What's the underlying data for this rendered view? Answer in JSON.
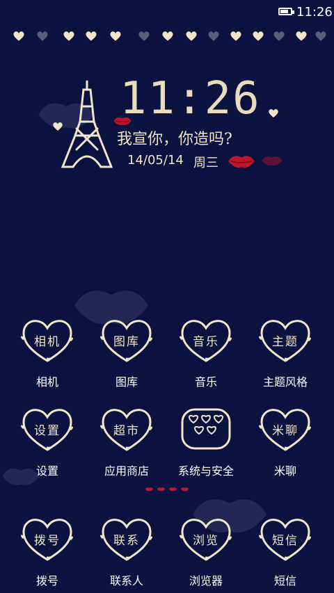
{
  "status_bar": {
    "time": "11:26",
    "battery_level": 0.8,
    "battery_icon": "battery-icon"
  },
  "heart_strip": {
    "icon": "heart-icon",
    "colors": [
      "#f1e6c9",
      "#5a5e78"
    ]
  },
  "clock_widget": {
    "time": "11:26",
    "slogan": "我宣你，你造吗?",
    "date": "14/05/14",
    "weekday": "周三",
    "icons": [
      "eiffel-tower-icon",
      "lips-icon"
    ],
    "accent_color": "#c0142a"
  },
  "apps": [
    {
      "icon_text": "相机",
      "label": "相机"
    },
    {
      "icon_text": "图库",
      "label": "图库"
    },
    {
      "icon_text": "音乐",
      "label": "音乐"
    },
    {
      "icon_text": "主题",
      "label": "主题风格"
    },
    {
      "icon_text": "设置",
      "label": "设置"
    },
    {
      "icon_text": "超市",
      "label": "应用商店"
    },
    {
      "icon_text": "",
      "label": "系统与安全"
    },
    {
      "icon_text": "米聊",
      "label": "米聊"
    }
  ],
  "page_indicator": {
    "pages": 4,
    "icon": "lips-icon"
  },
  "dock": [
    {
      "icon_text": "拨号",
      "label": "拨号"
    },
    {
      "icon_text": "联系",
      "label": "联系人"
    },
    {
      "icon_text": "浏览",
      "label": "浏览器"
    },
    {
      "icon_text": "短信",
      "label": "短信"
    }
  ],
  "colors": {
    "background": "#0b1240",
    "cream": "#f1e6c9",
    "muted_heart": "#5a5e78",
    "label": "#ffffff"
  }
}
